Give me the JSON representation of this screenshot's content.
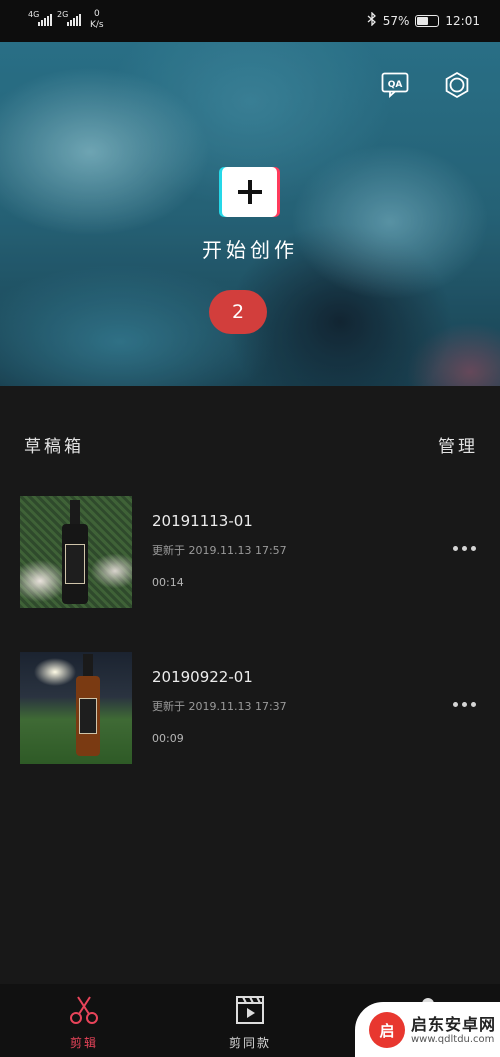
{
  "status_bar": {
    "network_1": "4G",
    "network_2": "2G",
    "speed_value": "0",
    "speed_unit": "K/s",
    "battery_text": "57%",
    "battery_level": 0.57,
    "time": "12:01"
  },
  "hero": {
    "qa_label": "QA",
    "create_label": "开始创作",
    "count_badge": "2"
  },
  "drafts": {
    "title": "草稿箱",
    "manage_label": "管理",
    "items": [
      {
        "title": "20191113-01",
        "updated": "更新于 2019.11.13 17:57",
        "duration": "00:14"
      },
      {
        "title": "20190922-01",
        "updated": "更新于 2019.11.13 17:37",
        "duration": "00:09"
      }
    ]
  },
  "bottom_nav": {
    "tabs": [
      {
        "label": "剪辑",
        "icon": "scissors-icon",
        "active": true
      },
      {
        "label": "剪同款",
        "icon": "clapperboard-icon",
        "active": false
      }
    ]
  },
  "watermark": {
    "logo_text": "启",
    "title": "启东安卓网",
    "url": "www.qdltdu.com"
  },
  "colors": {
    "accent": "#e9445a",
    "badge": "#d23e3c",
    "background": "#181818"
  }
}
